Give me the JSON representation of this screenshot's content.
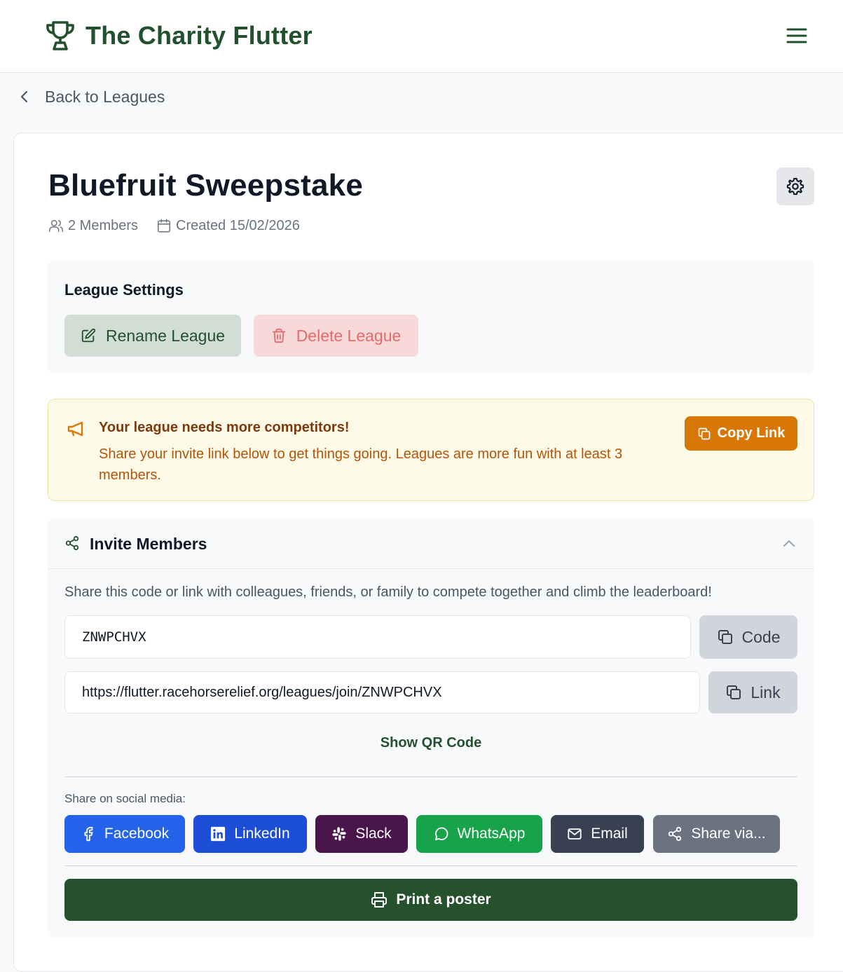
{
  "header": {
    "brand_name": "The Charity Flutter",
    "logo_icon": "trophy-icon",
    "menu_icon": "hamburger-menu-icon"
  },
  "nav": {
    "back_label": "Back to Leagues"
  },
  "league": {
    "title": "Bluefruit Sweepstake",
    "members": "2 Members",
    "created": "Created 15/02/2026"
  },
  "settings": {
    "heading": "League Settings",
    "rename_label": "Rename League",
    "delete_label": "Delete League"
  },
  "alert": {
    "title": "Your league needs more competitors!",
    "message": "Share your invite link below to get things going. Leagues are more fun with at least 3 members.",
    "copy_label": "Copy Link"
  },
  "invite": {
    "heading": "Invite Members",
    "description": "Share this code or link with colleagues, friends, or family to compete together and climb the leaderboard!",
    "code_value": "ZNWPCHVX",
    "code_button": "Code",
    "link_value": "https://flutter.racehorserelief.org/leagues/join/ZNWPCHVX",
    "link_button": "Link",
    "qr_label": "Show QR Code",
    "social_label": "Share on social media:",
    "social": [
      {
        "label": "Facebook",
        "color": "#2563eb",
        "icon": "facebook-icon"
      },
      {
        "label": "LinkedIn",
        "color": "#1d4ed8",
        "icon": "linkedin-icon"
      },
      {
        "label": "Slack",
        "color": "#4a154b",
        "icon": "slack-icon"
      },
      {
        "label": "WhatsApp",
        "color": "#16a34a",
        "icon": "whatsapp-icon"
      },
      {
        "label": "Email",
        "color": "#374151",
        "icon": "mail-icon"
      },
      {
        "label": "Share via...",
        "color": "#6b7280",
        "icon": "share-icon"
      }
    ],
    "print_label": "Print a poster"
  },
  "colors": {
    "brand": "#23512d",
    "alert_accent": "#d97706",
    "danger": "#e66a6a"
  }
}
